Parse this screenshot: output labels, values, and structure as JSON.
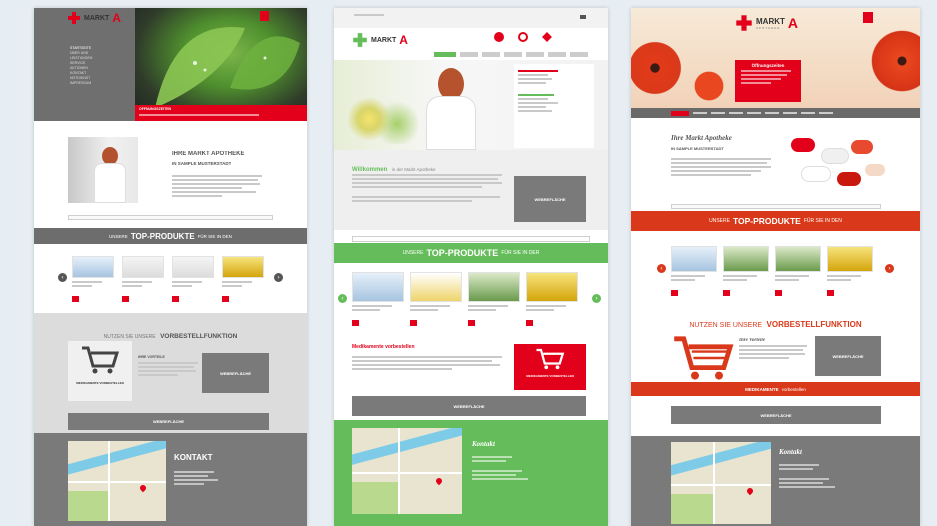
{
  "panel1": {
    "logo_text": "MARKT",
    "logo_letter": "A",
    "nav": [
      "STARTSEITE",
      "ÜBER UNS",
      "LEISTUNGEN",
      "SERVICE",
      "AKTIONEN",
      "KONTAKT",
      "NOTDIENST",
      "IMPRESSUM"
    ],
    "hours_label": "ÖFFNUNGSZEITEN",
    "intro_title": "IHRE MARKT APOTHEKE",
    "intro_sub": "IN SAMPLE MUSTERSTADT",
    "top_pre": "UNSERE",
    "top_main": "TOP-PRODUKTE",
    "top_post": "FÜR SIE IN DEN",
    "preorder_pre": "NUTZEN SIE UNSERE",
    "preorder_main": "VORBESTELLFUNKTION",
    "vorteile": "IHRE VORTEILE",
    "cart_label": "MEDIKAMENTE VORBESTELLEN",
    "button": "WEBREFLÄCHE",
    "contact": "KONTAKT"
  },
  "panel2": {
    "logo_text": "MARKT",
    "logo_letter": "A",
    "welcome": "Willkommen",
    "welcome_sub": "in der Markt Apotheke",
    "top_pre": "UNSERE",
    "top_main": "TOP-PRODUKTE",
    "top_post": "FÜR SIE IN DER",
    "preorder_title": "Medikamente vorbestellen",
    "cart_label": "MEDIKAMENTE VORBESTELLEN",
    "button": "WEBREFLÄCHE",
    "contact": "Kontakt"
  },
  "panel3": {
    "logo_text": "MARKT",
    "logo_letter": "A",
    "logo_sub": "APOTHEKE",
    "hours_label": "Öffnungszeiten",
    "intro_title": "Ihre Markt Apotheke",
    "intro_sub": "IN SAMPLE MUSTERSTADT",
    "top_pre": "UNSERE",
    "top_main": "TOP-PRODUKTE",
    "top_post": "FÜR SIE IN DEN",
    "preorder_pre": "NUTZEN SIE UNSERE",
    "preorder_main": "VORBESTELLFUNKTION",
    "vorteile": "Ihre Vorteile",
    "cart_label": "MEDIKAMENTE",
    "cart_label2": "vorbestellen",
    "button": "WEBREFLÄCHE",
    "contact": "Kontakt"
  },
  "colors": {
    "brand_red": "#e2001a",
    "brand_green": "#64bd5a",
    "gray_dark": "#7a7a7a",
    "orange_red": "#d9391a"
  }
}
